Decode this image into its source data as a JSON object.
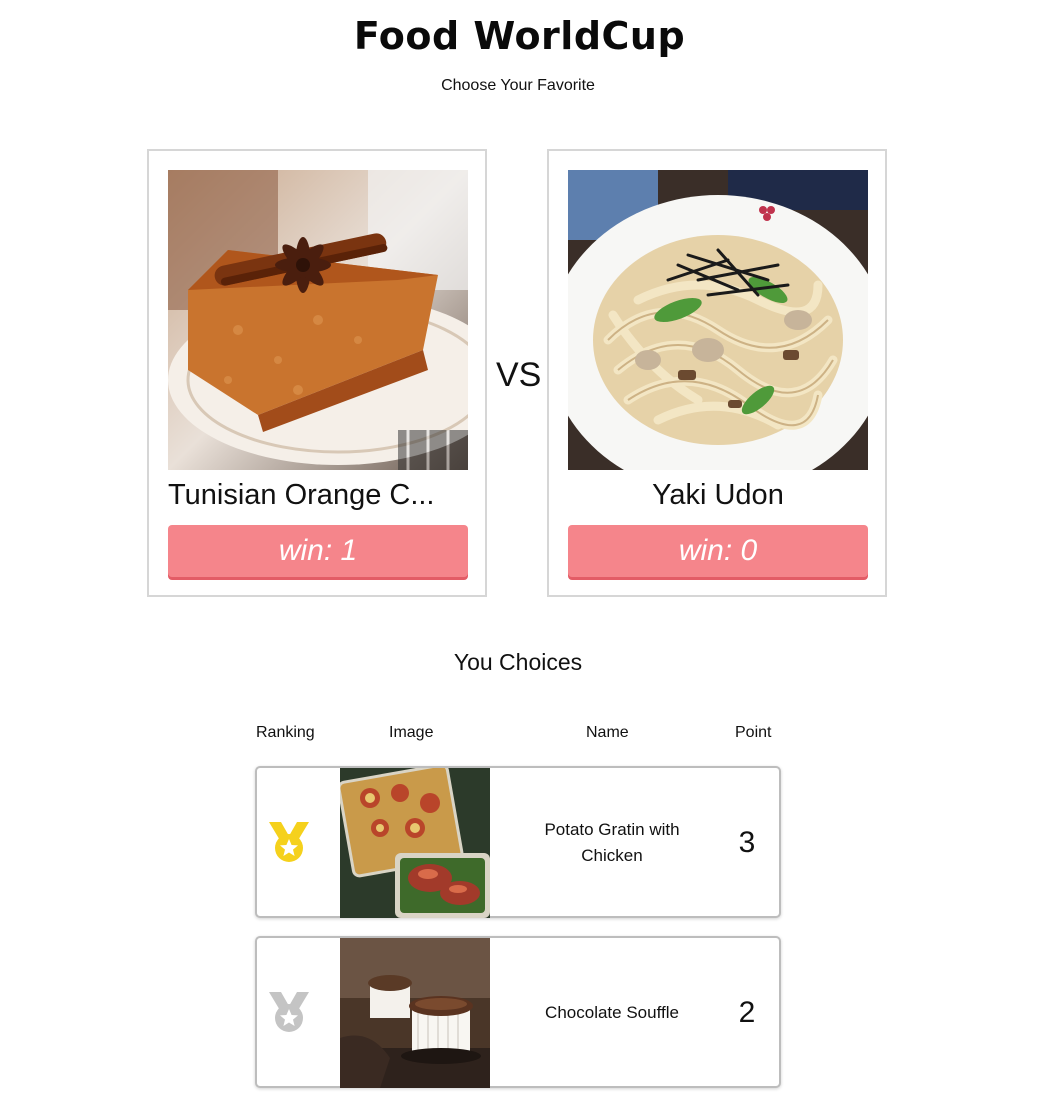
{
  "header": {
    "title": "Food WorldCup",
    "subtitle": "Choose Your Favorite"
  },
  "match": {
    "vs_label": "VS",
    "left": {
      "name": "Tunisian Orange C...",
      "win_label": "win: 1",
      "photo_icon": "orange-cake-photo"
    },
    "right": {
      "name": "Yaki Udon",
      "win_label": "win: 0",
      "photo_icon": "udon-photo"
    }
  },
  "choices": {
    "title": "You Choices",
    "columns": {
      "ranking": "Ranking",
      "image": "Image",
      "name": "Name",
      "point": "Point"
    },
    "rows": [
      {
        "rank_icon": "gold-medal-icon",
        "name": "Potato Gratin with Chicken",
        "point": "3"
      },
      {
        "rank_icon": "silver-medal-icon",
        "name": "Chocolate Souffle",
        "point": "2"
      }
    ]
  },
  "colors": {
    "win_button": "#f5858b",
    "gold": "#f5d11c",
    "silver": "#c4c4c4"
  }
}
